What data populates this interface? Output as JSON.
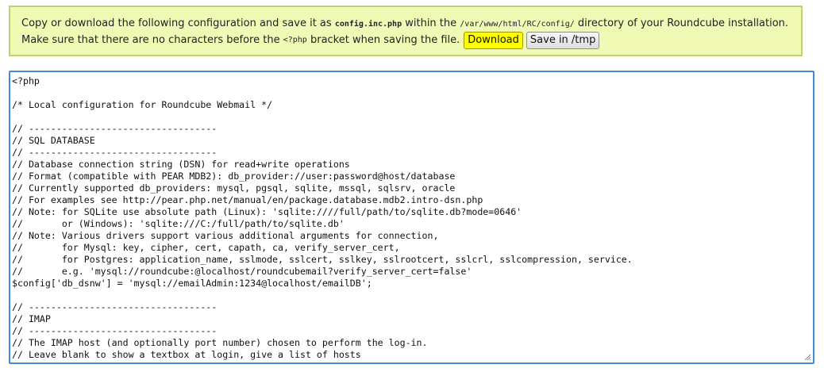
{
  "notice": {
    "line1_prefix": "Copy or download the following configuration and save it as ",
    "filename": "config.inc.php",
    "line1_middle": " within the ",
    "directory": "/var/www/html/RC/config/",
    "line1_suffix": " directory of your Roundcube installation.",
    "line2_prefix": "Make sure that there are no characters before the ",
    "php_tag": "<?php",
    "line2_suffix": " bracket when saving the file.",
    "download_label": "Download",
    "save_label": "Save in /tmp"
  },
  "config_lines": [
    "<?php",
    "",
    "/* Local configuration for Roundcube Webmail */",
    "",
    "// ----------------------------------",
    "// SQL DATABASE",
    "// ----------------------------------",
    "// Database connection string (DSN) for read+write operations",
    "// Format (compatible with PEAR MDB2): db_provider://user:password@host/database",
    "// Currently supported db_providers: mysql, pgsql, sqlite, mssql, sqlsrv, oracle",
    "// For examples see http://pear.php.net/manual/en/package.database.mdb2.intro-dsn.php",
    "// Note: for SQLite use absolute path (Linux): 'sqlite:////full/path/to/sqlite.db?mode=0646'",
    "//       or (Windows): 'sqlite:///C:/full/path/to/sqlite.db'",
    "// Note: Various drivers support various additional arguments for connection,",
    "//       for Mysql: key, cipher, cert, capath, ca, verify_server_cert,",
    "//       for Postgres: application_name, sslmode, sslcert, sslkey, sslrootcert, sslcrl, sslcompression, service.",
    "//       e.g. 'mysql://roundcube:@localhost/roundcubemail?verify_server_cert=false'",
    "$config['db_dsnw'] = 'mysql://emailAdmin:1234@localhost/emailDB';",
    "",
    "// ----------------------------------",
    "// IMAP",
    "// ----------------------------------",
    "// The IMAP host (and optionally port number) chosen to perform the log-in.",
    "// Leave blank to show a textbox at login, give a list of hosts"
  ]
}
